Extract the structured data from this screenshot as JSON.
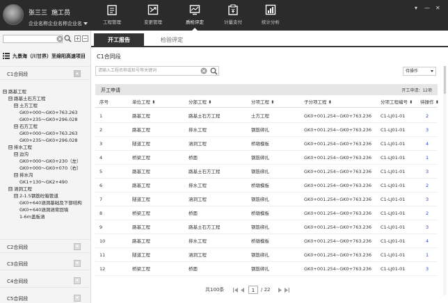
{
  "user": {
    "name": "张三三",
    "role": "施工员",
    "company": "企业名称企业名称企业名"
  },
  "nav": [
    {
      "label": "工程管理",
      "icon": "clipboard-icon"
    },
    {
      "label": "变更管理",
      "icon": "swap-icon"
    },
    {
      "label": "质检评定",
      "icon": "monitor-chart-icon",
      "active": true
    },
    {
      "label": "计量支付",
      "icon": "payment-icon"
    },
    {
      "label": "统计分析",
      "icon": "stats-icon"
    }
  ],
  "window_controls": [
    "▾",
    "—",
    "✕"
  ],
  "sidebar": {
    "search_clear": "✕",
    "project": "九景海（川甘界）至绵阳高速项目",
    "sections": [
      "C1合同段",
      "C2合同段",
      "C3合同段",
      "C4合同段",
      "C5合同段"
    ],
    "tree": [
      {
        "label": "路基工程",
        "exp": "⊟"
      },
      {
        "label": "路基土石方工程",
        "exp": "⊟"
      },
      {
        "label": "土方工程",
        "exp": "⊟"
      },
      {
        "label": "GK0+000～GK0+763.263",
        "exp": ""
      },
      {
        "label": "GK0+235～GK0+296.028",
        "exp": ""
      },
      {
        "label": "石方工程",
        "exp": "⊟"
      },
      {
        "label": "GK0+000～GK0+763.263",
        "exp": ""
      },
      {
        "label": "GK0+235～GK0+296.028",
        "exp": ""
      },
      {
        "label": "排水工程",
        "exp": "⊟"
      },
      {
        "label": "边沟",
        "exp": "⊟"
      },
      {
        "label": "GK0+000～GK0+230（左）",
        "exp": ""
      },
      {
        "label": "GK0+000～GK0+070（右）",
        "exp": ""
      },
      {
        "label": "排水沟",
        "exp": "⊟"
      },
      {
        "label": "GK1+130～GK2+490",
        "exp": ""
      },
      {
        "label": "涵洞工程",
        "exp": "⊟"
      },
      {
        "label": "2-1.5钢筋砼箱管道",
        "exp": "⊟"
      },
      {
        "label": "GK0+640涵洞基础及下部结构",
        "exp": ""
      },
      {
        "label": "GK0+640涵洞涵背回填",
        "exp": ""
      },
      {
        "label": "1-6m盖板涵",
        "exp": ""
      }
    ]
  },
  "tabs": [
    "开工报告",
    "检验评定"
  ],
  "main": {
    "title": "C1合同段",
    "search_placeholder": "请输入工程名称或桩号等关键词",
    "select_value": "待操作",
    "table_title": "开工申请",
    "table_summary": "开工申请：12项",
    "columns": [
      "序号",
      "单位工程 ⬍",
      "分部工程 ⬍",
      "分项工程 ⬍",
      "子分项工程 ⬍",
      "分项工程编号 ⬍",
      "待操作 ⬍"
    ],
    "rows": [
      [
        "1",
        "路基工程",
        "路基土石方工程",
        "土方工程",
        "GK0+001.254~GK0+763.236",
        "C1-LJ01-01",
        "2"
      ],
      [
        "2",
        "路基工程",
        "排水工程",
        "钢筋绑扎",
        "GK0+001.254~GK0+763.236",
        "C1-LJ01-01",
        "3"
      ],
      [
        "3",
        "隧道工程",
        "涵洞工程",
        "桥墩模板",
        "GK0+001.254~GK0+763.236",
        "C1-LJ01-01",
        "4"
      ],
      [
        "4",
        "桥梁工程",
        "桥面",
        "钢筋绑扎",
        "GK0+001.254~GK0+763.236",
        "C1-LJ01-01",
        "1"
      ],
      [
        "5",
        "路基工程",
        "路基土石方工程",
        "钢筋绑扎",
        "GK0+001.254~GK0+763.236",
        "C1-LJ01-01",
        "3"
      ],
      [
        "6",
        "路基工程",
        "排水工程",
        "桥墩模板",
        "GK0+001.254~GK0+763.236",
        "C1-LJ01-01",
        "2"
      ],
      [
        "7",
        "隧道工程",
        "涵洞工程",
        "钢筋绑扎",
        "GK0+001.254~GK0+763.236",
        "C1-LJ01-01",
        "3"
      ],
      [
        "8",
        "桥梁工程",
        "桥面",
        "桥墩模板",
        "GK0+001.254~GK0+763.236",
        "C1-LJ01-01",
        "2"
      ],
      [
        "9",
        "路基工程",
        "路基土石方工程",
        "钢筋绑扎",
        "GK0+001.254~GK0+763.236",
        "C1-LJ01-01",
        "3"
      ],
      [
        "10",
        "路基工程",
        "排水工程",
        "桥墩模板",
        "GK0+001.254~GK0+763.236",
        "C1-LJ01-01",
        "4"
      ],
      [
        "11",
        "隧道工程",
        "涵洞工程",
        "钢筋绑扎",
        "GK0+001.254~GK0+763.236",
        "C1-LJ01-01",
        "1"
      ],
      [
        "12",
        "桥梁工程",
        "桥面",
        "钢筋绑扎",
        "GK0+001.254~GK0+763.236",
        "C1-LJ01-01",
        "3"
      ]
    ],
    "pager": {
      "total": "共100条",
      "page": "1",
      "pages": "/ 22"
    }
  }
}
